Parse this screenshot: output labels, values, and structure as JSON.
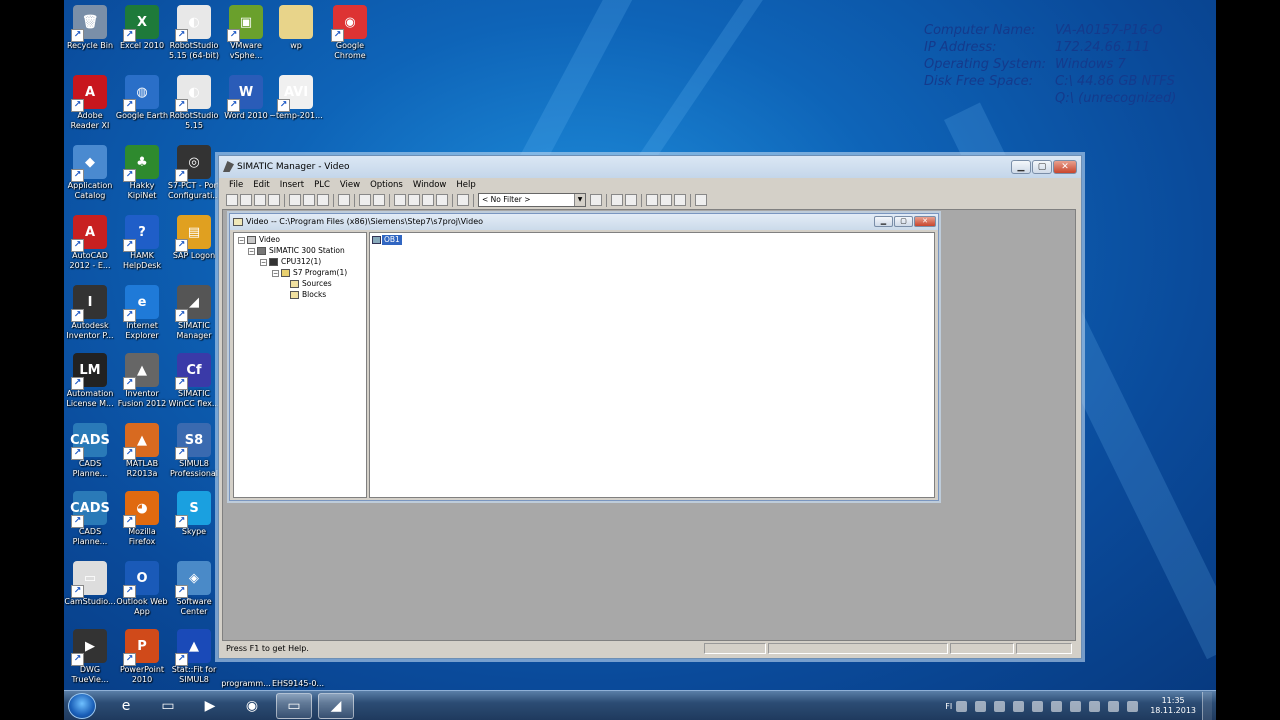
{
  "desktop": {
    "icons": [
      {
        "label": "Recycle Bin",
        "glyph": "🗑",
        "color": "#7a8fa8"
      },
      {
        "label": "Excel 2010",
        "glyph": "X",
        "color": "#1e7a3a"
      },
      {
        "label": "RobotStudio\n5.15 (64-bit)",
        "glyph": "◐",
        "color": "#e8e8e8"
      },
      {
        "label": "VMware\nvSphe...",
        "glyph": "▣",
        "color": "#6aa02c"
      },
      {
        "label": "wp",
        "glyph": "",
        "color": "#e8d48a"
      },
      {
        "label": "Google\nChrome",
        "glyph": "◉",
        "color": "#d33"
      },
      {
        "label": "Adobe\nReader XI",
        "glyph": "A",
        "color": "#c8161d"
      },
      {
        "label": "Google Earth",
        "glyph": "◍",
        "color": "#2a6fc8"
      },
      {
        "label": "RobotStudio\n5.15",
        "glyph": "◐",
        "color": "#e8e8e8"
      },
      {
        "label": "Word 2010",
        "glyph": "W",
        "color": "#2a5cb8"
      },
      {
        "label": "~temp-201...",
        "glyph": "AVI",
        "color": "#f0f0f0"
      },
      {
        "label": "Application\nCatalog",
        "glyph": "◆",
        "color": "#4a8ad0"
      },
      {
        "label": "Hakky\nKipiNet",
        "glyph": "♣",
        "color": "#2e8a2e"
      },
      {
        "label": "S7-PCT - Port\nConfigurati...",
        "glyph": "◎",
        "color": "#333"
      },
      {
        "label": "AutoCAD\n2012 - E...",
        "glyph": "A",
        "color": "#c82020"
      },
      {
        "label": "HAMK\nHelpDesk",
        "glyph": "?",
        "color": "#1f5ec8"
      },
      {
        "label": "SAP Logon",
        "glyph": "▤",
        "color": "#e0a020"
      },
      {
        "label": "Autodesk\nInventor P...",
        "glyph": "I",
        "color": "#333"
      },
      {
        "label": "Internet\nExplorer",
        "glyph": "e",
        "color": "#1f7ad8"
      },
      {
        "label": "SIMATIC\nManager",
        "glyph": "◢",
        "color": "#555"
      },
      {
        "label": "Automation\nLicense M...",
        "glyph": "LM",
        "color": "#222"
      },
      {
        "label": "Inventor\nFusion 2012",
        "glyph": "▲",
        "color": "#666"
      },
      {
        "label": "SIMATIC\nWinCC flex...",
        "glyph": "Cf",
        "color": "#3a3aa8"
      },
      {
        "label": "CADS\nPlanne...",
        "glyph": "CADS",
        "color": "#2a7ab8"
      },
      {
        "label": "MATLAB\nR2013a",
        "glyph": "▲",
        "color": "#d86a20"
      },
      {
        "label": "SIMUL8\nProfessional",
        "glyph": "S8",
        "color": "#3a6ab0"
      },
      {
        "label": "CADS\nPlanne...",
        "glyph": "CADS",
        "color": "#2a7ab8"
      },
      {
        "label": "Mozilla\nFirefox",
        "glyph": "◕",
        "color": "#e06a10"
      },
      {
        "label": "Skype",
        "glyph": "S",
        "color": "#1aa0e0"
      },
      {
        "label": "CamStudio...",
        "glyph": "▭",
        "color": "#ddd"
      },
      {
        "label": "Outlook Web\nApp",
        "glyph": "O",
        "color": "#1a5ab8"
      },
      {
        "label": "Software\nCenter",
        "glyph": "◈",
        "color": "#4a8ac8"
      },
      {
        "label": "DWG\nTrueVie...",
        "glyph": "▶",
        "color": "#333"
      },
      {
        "label": "PowerPoint\n2010",
        "glyph": "P",
        "color": "#d04a1a"
      },
      {
        "label": "Stat::Fit for\nSIMUL8",
        "glyph": "▲",
        "color": "#1a4ab8"
      },
      {
        "label": "programm...",
        "glyph": "",
        "color": "transparent"
      },
      {
        "label": "EHS9145-0...",
        "glyph": "",
        "color": "transparent"
      }
    ],
    "sysinfo": [
      {
        "k": "Computer Name:",
        "v": "VA-A0157-P16-O"
      },
      {
        "k": "IP Address:",
        "v": "172.24.66.111"
      },
      {
        "k": "Operating System:",
        "v": "Windows 7"
      },
      {
        "k": "Disk Free Space:",
        "v": "C:\\ 44.86 GB NTFS"
      },
      {
        "k": "",
        "v": "Q:\\ (unrecognized)"
      }
    ]
  },
  "window": {
    "title": "SIMATIC Manager - Video",
    "menu": [
      "File",
      "Edit",
      "Insert",
      "PLC",
      "View",
      "Options",
      "Window",
      "Help"
    ],
    "filter": "< No Filter >",
    "status": "Press F1 to get Help."
  },
  "child": {
    "title": "Video -- C:\\Program Files (x86)\\Siemens\\Step7\\s7proj\\Video",
    "tree": [
      {
        "label": "Video",
        "exp": "−",
        "cls": "proj"
      },
      {
        "label": "SIMATIC 300 Station",
        "exp": "−",
        "cls": "stat"
      },
      {
        "label": "CPU312(1)",
        "exp": "−",
        "cls": "cpu"
      },
      {
        "label": "S7 Program(1)",
        "exp": "−",
        "cls": "prog"
      },
      {
        "label": "Sources",
        "exp": "",
        "cls": "fold"
      },
      {
        "label": "Blocks",
        "exp": "",
        "cls": "fold"
      }
    ],
    "list_item": "OB1"
  },
  "taskbar": {
    "tray_lang": "FI",
    "time": "11:35",
    "date": "18.11.2013"
  }
}
